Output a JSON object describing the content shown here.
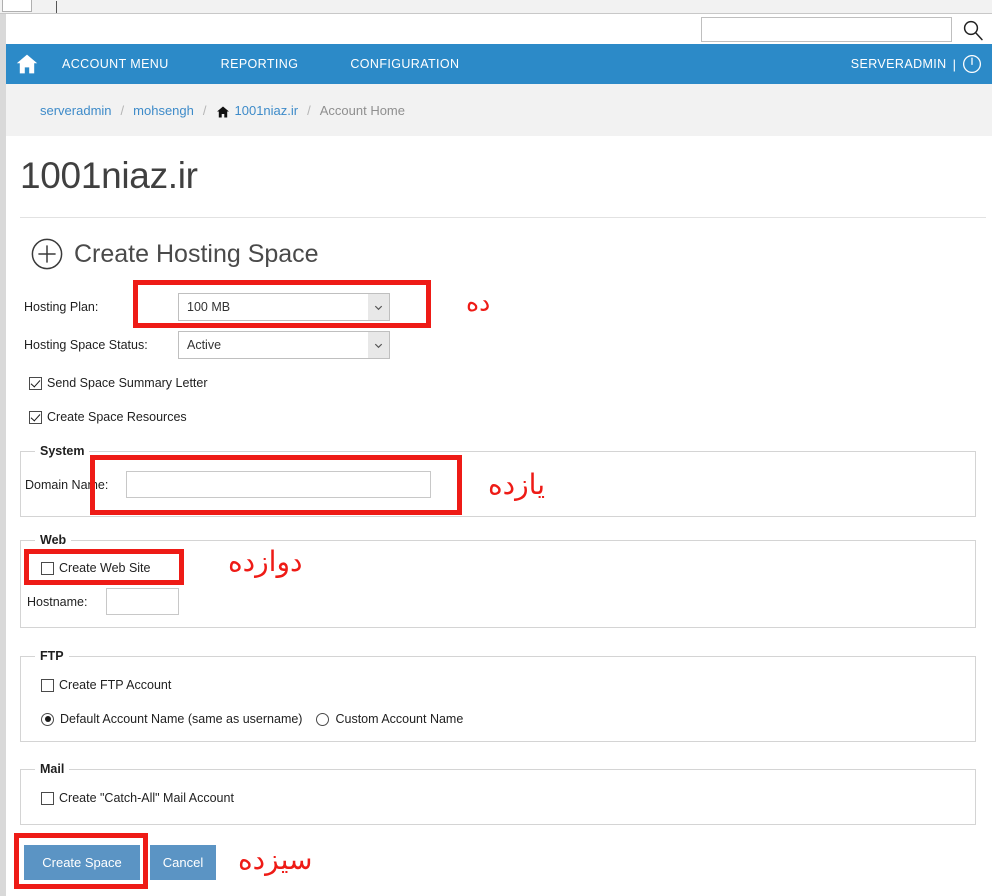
{
  "browser": {
    "search": {
      "value": "",
      "placeholder": ""
    },
    "search_icon": "search-icon"
  },
  "navbar": {
    "home_icon": "home-icon",
    "links": [
      {
        "label": "ACCOUNT MENU"
      },
      {
        "label": "REPORTING"
      },
      {
        "label": "CONFIGURATION"
      }
    ],
    "user": "SERVERADMIN",
    "separator": "|",
    "power_icon": "power-icon",
    "background_color": "#2c8ac8"
  },
  "breadcrumb": {
    "separator": "/",
    "items": [
      {
        "label": "serveradmin",
        "current": false,
        "icon": null
      },
      {
        "label": "mohsengh",
        "current": false,
        "icon": null
      },
      {
        "label": "1001niaz.ir",
        "current": false,
        "icon": "home-icon"
      },
      {
        "label": "Account Home",
        "current": true,
        "icon": null
      }
    ]
  },
  "page": {
    "title": "1001niaz.ir",
    "section_heading": "Create Hosting Space",
    "section_icon": "plus-circle-icon"
  },
  "form": {
    "hosting_plan": {
      "label": "Hosting Plan:",
      "value": "100 MB",
      "arrow_icon": "chevron-down-icon"
    },
    "hosting_space_status": {
      "label": "Hosting Space Status:",
      "value": "Active",
      "arrow_icon": "chevron-down-icon"
    },
    "checkboxes": [
      {
        "label": "Send Space Summary Letter",
        "checked": true
      },
      {
        "label": "Create Space Resources",
        "checked": true
      }
    ],
    "system": {
      "legend": "System",
      "domain_name": {
        "label": "Domain Name:",
        "value": "",
        "placeholder": ""
      }
    },
    "web": {
      "legend": "Web",
      "create_web_site": {
        "label": "Create Web Site",
        "checked": false
      },
      "hostname": {
        "label": "Hostname:",
        "value": "",
        "placeholder": ""
      }
    },
    "ftp": {
      "legend": "FTP",
      "create_ftp_account": {
        "label": "Create FTP Account",
        "checked": false
      },
      "radios": [
        {
          "label": "Default Account Name (same as username)",
          "selected": true
        },
        {
          "label": "Custom Account Name",
          "selected": false
        }
      ]
    },
    "mail": {
      "legend": "Mail",
      "catch_all": {
        "label": "Create \"Catch-All\" Mail Account",
        "checked": false
      }
    },
    "actions": {
      "submit_label": "Create Space",
      "cancel_label": "Cancel"
    }
  },
  "annotations": {
    "color": "#ee1b16",
    "items": [
      {
        "text": "ده",
        "meaning": "ten"
      },
      {
        "text": "یازده",
        "meaning": "eleven"
      },
      {
        "text": "دوازده",
        "meaning": "twelve"
      },
      {
        "text": "سیزده",
        "meaning": "thirteen"
      }
    ]
  }
}
